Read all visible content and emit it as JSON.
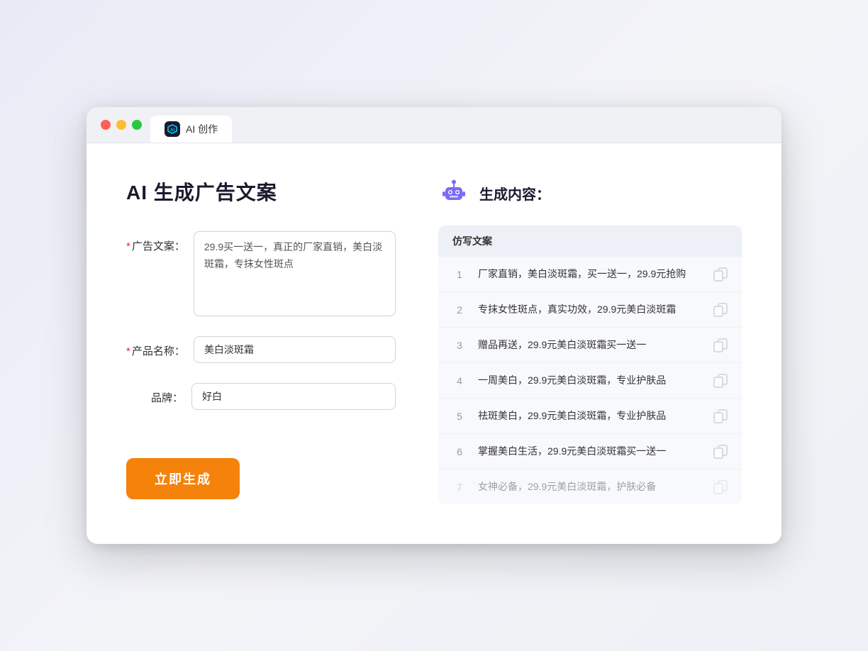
{
  "window": {
    "tab_label": "AI 创作",
    "tab_icon_text": "AI"
  },
  "left_panel": {
    "title": "AI 生成广告文案",
    "fields": {
      "ad_copy_label": "广告文案：",
      "ad_copy_required": "*",
      "ad_copy_value": "29.9买一送一，真正的厂家直销，美白淡斑霜，专抹女性斑点",
      "product_name_label": "产品名称：",
      "product_name_required": "*",
      "product_name_value": "美白淡斑霜",
      "brand_label": "品牌：",
      "brand_value": "好白"
    },
    "generate_button": "立即生成"
  },
  "right_panel": {
    "header_title": "生成内容：",
    "table_header": "仿写文案",
    "results": [
      {
        "num": "1",
        "text": "厂家直销，美白淡斑霜，买一送一，29.9元抢购",
        "faded": false
      },
      {
        "num": "2",
        "text": "专抹女性斑点，真实功效，29.9元美白淡斑霜",
        "faded": false
      },
      {
        "num": "3",
        "text": "赠品再送，29.9元美白淡斑霜买一送一",
        "faded": false
      },
      {
        "num": "4",
        "text": "一周美白，29.9元美白淡斑霜，专业护肤品",
        "faded": false
      },
      {
        "num": "5",
        "text": "祛斑美白，29.9元美白淡斑霜，专业护肤品",
        "faded": false
      },
      {
        "num": "6",
        "text": "掌握美白生活，29.9元美白淡斑霜买一送一",
        "faded": false
      },
      {
        "num": "7",
        "text": "女神必备，29.9元美白淡斑霜，护肤必备",
        "faded": true
      }
    ]
  }
}
